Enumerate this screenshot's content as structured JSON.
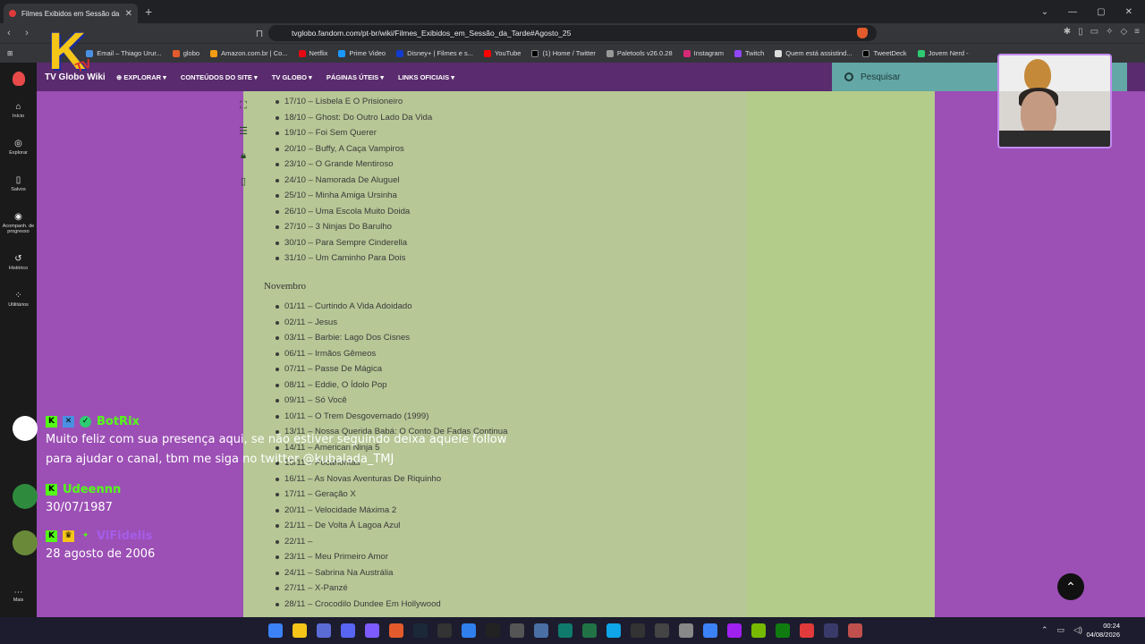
{
  "browser": {
    "tab_title": "Filmes Exibidos em Sessão da Ta",
    "url": "tvglobo.fandom.com/pt-br/wiki/Filmes_Exibidos_em_Sessão_da_Tarde#Agosto_25",
    "bookmarks": [
      "Email – Thiago Urur...",
      "globo",
      "Amazon.com.br | Co...",
      "Netflix",
      "Prime Video",
      "Disney+ | Filmes e s...",
      "YouTube",
      "(1) Home / Twitter",
      "Paletools v26.0.28",
      "Instagram",
      "Twitch",
      "Quem está assistind...",
      "TweetDeck",
      "Jovem Nerd -"
    ]
  },
  "fandom": {
    "wiki_name": "TV Globo Wiki",
    "nav": [
      "EXPLORAR",
      "CONTEÚDOS DO SITE",
      "TV GLOBO",
      "PÁGINAS ÚTEIS",
      "LINKS OFICIAIS"
    ],
    "search_placeholder": "Pesquisar"
  },
  "rail": {
    "items": [
      "Início",
      "Explorar",
      "Salvos",
      "Acompanh. de progresso",
      "Histórico",
      "Utilitários"
    ],
    "more": "Mais"
  },
  "article": {
    "october": [
      "17/10 – Lisbela E O Prisioneiro",
      "18/10 – Ghost: Do Outro Lado Da Vida",
      "19/10 – Foi Sem Querer",
      "20/10 – Buffy, A Caça Vampiros",
      "23/10 – O Grande Mentiroso",
      "24/10 – Namorada De Aluguel",
      "25/10 – Minha Amiga Ursinha",
      "26/10 – Uma Escola Muito Doida",
      "27/10 – 3 Ninjas Do Barulho",
      "30/10 – Para Sempre Cinderella",
      "31/10 – Um Caminho Para Dois"
    ],
    "november_heading": "Novembro",
    "november": [
      "01/11 – Curtindo A Vida Adoidado",
      "02/11 – Jesus",
      "03/11 – Barbie: Lago Dos Cisnes",
      "06/11 – Irmãos Gêmeos",
      "07/11 – Passe De Mágica",
      "08/11 – Eddie, O Ídolo Pop",
      "09/11 – Só Você",
      "10/11 – O Trem Desgovernado (1999)",
      "13/11 – Nossa Querida Babá: O Conto De Fadas Continua",
      "14/11 – American Ninja 5",
      "15/11 – Pocahontas",
      "16/11 – As Novas Aventuras De Riquinho",
      "17/11 – Geração X",
      "20/11 – Velocidade Máxima 2",
      "21/11 – De Volta À Lagoa Azul",
      "22/11 –",
      "23/11 – Meu Primeiro Amor",
      "24/11 – Sabrina Na Austrália",
      "27/11 – X-Panzé",
      "28/11 – Crocodilo Dundee Em Hollywood"
    ]
  },
  "chat": [
    {
      "user": "BotRix",
      "color": "#53fc18",
      "message": "Muito feliz com sua presença aqui, se não estiver seguindo deixa aquele follow para ajudar o canal, tbm me siga no twitter @kubalada_TMJ"
    },
    {
      "user": "Udeennn",
      "color": "#53fc18",
      "message": "30/07/1987"
    },
    {
      "user": "ViFidelis",
      "color": "#a45ee8",
      "message": "28 agosto de 2006"
    }
  ],
  "taskbar": {
    "time": "00:24",
    "date": "04/08/2026"
  }
}
